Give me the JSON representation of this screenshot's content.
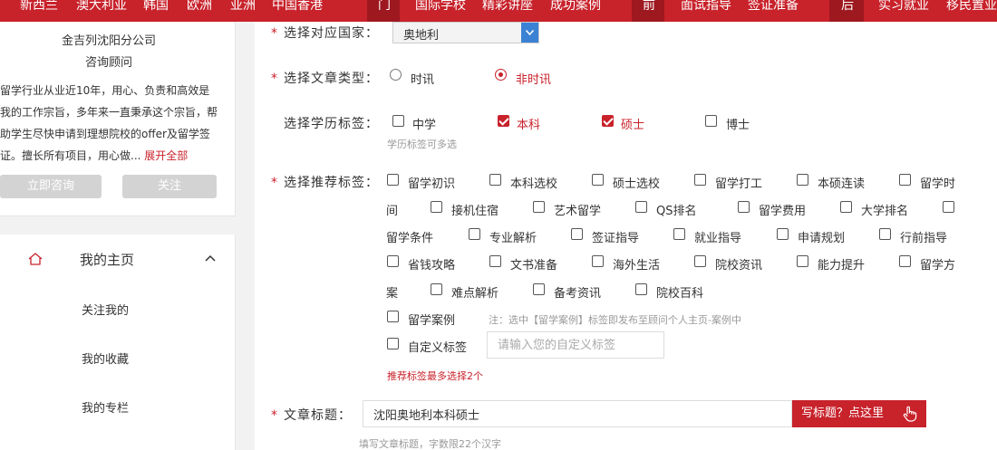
{
  "top_nav": {
    "items": [
      "新西兰",
      "澳大利亚",
      "韩国",
      "欧洲",
      "亚洲",
      "中国香港"
    ],
    "block1": "门",
    "items2": [
      "国际学校",
      "精彩讲座",
      "成功案例"
    ],
    "block2": "前",
    "items3": [
      "面试指导",
      "签证准备"
    ],
    "block3": "后",
    "items4": [
      "实习就业",
      "移民置业"
    ]
  },
  "consultant": {
    "company": "金吉列沈阳分公司",
    "role": "咨询顾问",
    "intro_lines": [
      "留学行业从业近10年，用心、负责和高效是",
      "我的工作宗旨，多年来一直秉承这个宗旨，帮",
      "助学生尽快申请到理想院校的offer及留学签",
      "证。擅长所有项目，用心做..."
    ],
    "expand_label": "展开全部",
    "consult_button": "立即咨询",
    "follow_button": "关注"
  },
  "side_menu": {
    "title": "我的主页",
    "items": [
      "关注我的",
      "我的收藏",
      "我的专栏"
    ]
  },
  "form": {
    "country": {
      "label": "选择对应国家：",
      "value": "奥地利"
    },
    "article_type": {
      "label": "选择文章类型：",
      "options": [
        {
          "label": "时讯",
          "selected": false
        },
        {
          "label": "非时讯",
          "selected": true
        }
      ]
    },
    "education": {
      "label": "选择学历标签：",
      "options": [
        {
          "label": "中学",
          "checked": false
        },
        {
          "label": "本科",
          "checked": true
        },
        {
          "label": "硕士",
          "checked": true
        },
        {
          "label": "博士",
          "checked": false
        }
      ],
      "hint": "学历标签可多选"
    },
    "recommend": {
      "label": "选择推荐标签：",
      "row1": [
        "留学初识",
        "本科选校",
        "硕士选校",
        "留学打工",
        "本硕连读",
        "留学时"
      ],
      "row2_lead": "间",
      "row2": [
        "接机住宿",
        "艺术留学",
        "QS排名",
        "留学费用",
        "大学排名"
      ],
      "row3": [
        "留学条件",
        "专业解析",
        "签证指导",
        "就业指导",
        "申请规划",
        "行前指导"
      ],
      "row4": [
        "省钱攻略",
        "文书准备",
        "海外生活",
        "院校资讯",
        "能力提升",
        "留学方"
      ],
      "row5_lead": "案",
      "row5": [
        "难点解析",
        "备考资讯",
        "院校百科"
      ],
      "case_label": "留学案例",
      "case_note": "注：选中【留学案例】标签即发布至顾问个人主页-案例中",
      "custom_label": "自定义标签",
      "custom_placeholder": "请输入您的自定义标签",
      "limit_warning": "推荐标签最多选择2个"
    },
    "title": {
      "label": "文章标题：",
      "value": "沈阳奥地利本科硕士",
      "button": "写标题？点这里",
      "hint": "填写文章标题，字数限22个汉字"
    }
  },
  "colors": {
    "brand_red": "#c8222b",
    "select_blue": "#3b82d4"
  }
}
